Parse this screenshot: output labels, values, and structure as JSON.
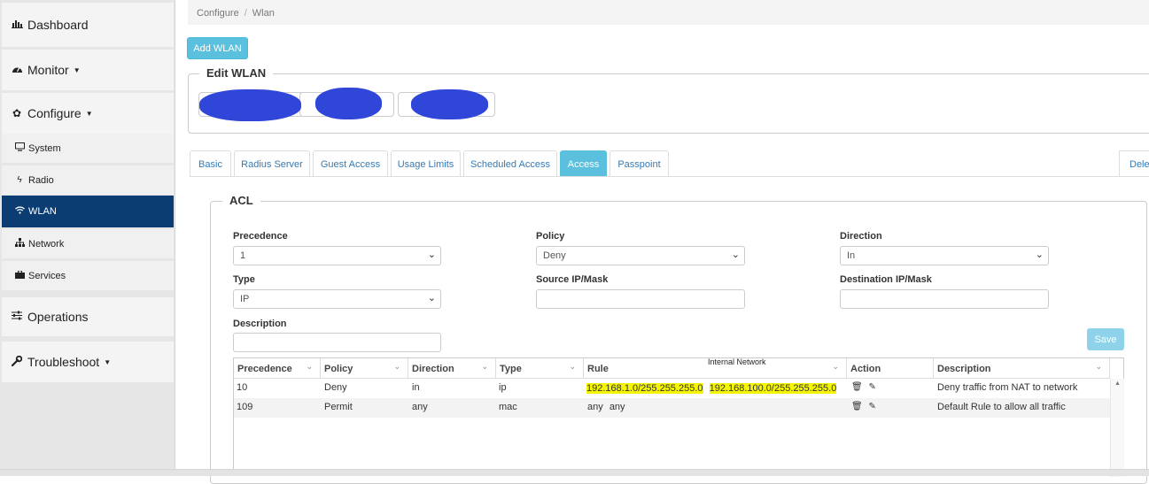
{
  "sidebar": {
    "dashboard": "Dashboard",
    "monitor": "Monitor",
    "configure": "Configure",
    "system": "System",
    "radio": "Radio",
    "wlan": "WLAN",
    "network": "Network",
    "services": "Services",
    "operations": "Operations",
    "troubleshoot": "Troubleshoot"
  },
  "breadcrumb": {
    "item1": "Configure",
    "sep": "/",
    "item2": "Wlan"
  },
  "add_wlan": "Add WLAN",
  "edit_wlan_legend": "Edit WLAN",
  "tabs": [
    "Basic",
    "Radius Server",
    "Guest Access",
    "Usage Limits",
    "Scheduled Access",
    "Access",
    "Passpoint"
  ],
  "delete_tab": "Delete",
  "acl": {
    "legend": "ACL",
    "precedence_label": "Precedence",
    "precedence_value": "1",
    "policy_label": "Policy",
    "policy_value": "Deny",
    "direction_label": "Direction",
    "direction_value": "In",
    "type_label": "Type",
    "type_value": "IP",
    "source_label": "Source IP/Mask",
    "source_value": "",
    "dest_label": "Destination IP/Mask",
    "dest_value": "",
    "description_label": "Description",
    "description_value": "",
    "save": "Save"
  },
  "table": {
    "headers": [
      "Precedence",
      "Policy",
      "Direction",
      "Type",
      "Rule",
      "Action",
      "Description"
    ],
    "rule_annotation": "Internal Network",
    "rows": [
      {
        "precedence": "10",
        "policy": "Deny",
        "direction": "in",
        "type": "ip",
        "rule_src": "192.168.1.0/255.255.255.0",
        "rule_dst": "192.168.100.0/255.255.255.0",
        "description": "Deny traffic from NAT to network"
      },
      {
        "precedence": "109",
        "policy": "Permit",
        "direction": "any",
        "type": "mac",
        "rule_src": "any",
        "rule_dst": "any",
        "description": "Default Rule to allow all traffic"
      }
    ]
  },
  "icons": {
    "dashboard": "bar-chart-icon",
    "monitor": "gauge-icon",
    "configure": "gear-icon",
    "system": "monitor-icon",
    "radio": "bolt-icon",
    "wlan": "wifi-icon",
    "network": "sitemap-icon",
    "services": "briefcase-icon",
    "operations": "sliders-icon",
    "troubleshoot": "wrench-icon",
    "delete": "trash-icon",
    "edit": "edit-icon"
  },
  "colors": {
    "accent": "#5bc0de",
    "active_nav": "#0b3d73",
    "highlight": "#f5f500",
    "redaction": "#2f46d8"
  }
}
